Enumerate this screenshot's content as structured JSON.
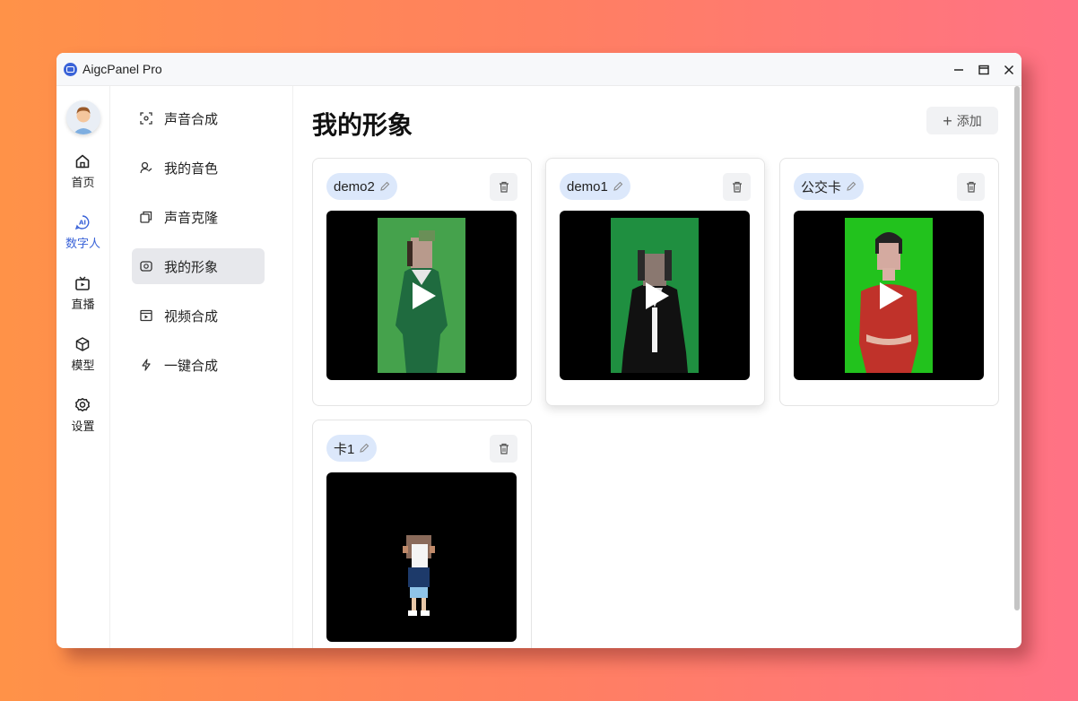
{
  "app": {
    "title": "AigcPanel Pro"
  },
  "rail": [
    {
      "label": "首页",
      "icon": "home-icon"
    },
    {
      "label": "数字人",
      "icon": "ai-icon",
      "active": true
    },
    {
      "label": "直播",
      "icon": "tv-icon"
    },
    {
      "label": "模型",
      "icon": "cube-icon"
    },
    {
      "label": "设置",
      "icon": "gear-icon"
    }
  ],
  "submenu": [
    {
      "label": "声音合成",
      "icon": "scan-icon"
    },
    {
      "label": "我的音色",
      "icon": "user-voice-icon"
    },
    {
      "label": "声音克隆",
      "icon": "copy-icon"
    },
    {
      "label": "我的形象",
      "icon": "avatar-frame-icon",
      "active": true
    },
    {
      "label": "视频合成",
      "icon": "video-icon"
    },
    {
      "label": "一键合成",
      "icon": "bolt-icon"
    }
  ],
  "main": {
    "title": "我的形象",
    "add_label": "添加",
    "cards": [
      {
        "name": "demo2",
        "bg": "#2f8a3a"
      },
      {
        "name": "demo1",
        "bg": "#1e8c3b"
      },
      {
        "name": "公交卡",
        "bg": "#22c21d"
      },
      {
        "name": "卡1",
        "bg": "#000000"
      }
    ]
  },
  "colors": {
    "accent": "#3a63d8",
    "tag_bg": "#dce8fb",
    "active_bg": "#e7e8ec"
  }
}
